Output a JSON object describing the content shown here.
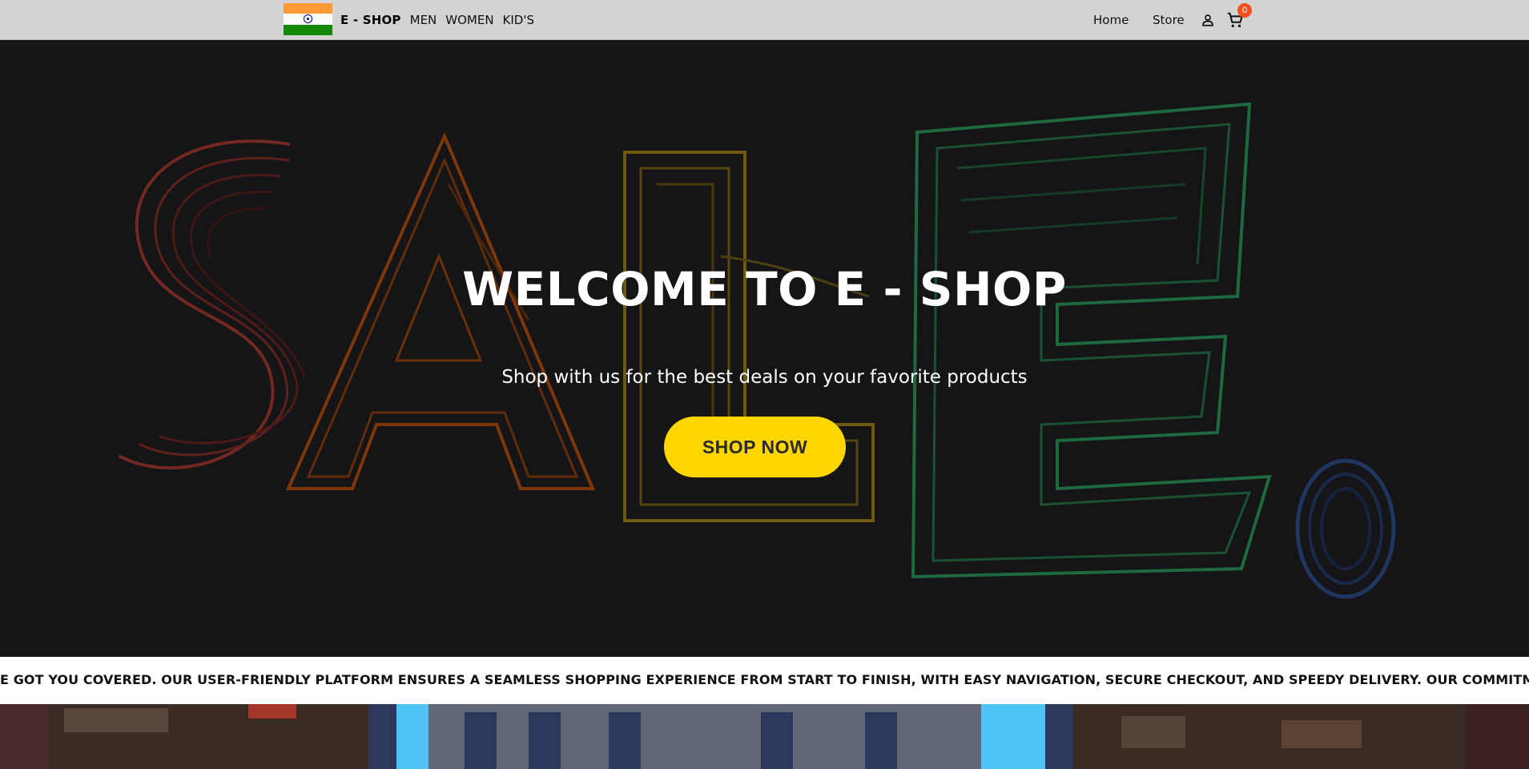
{
  "navbar": {
    "brand": "E - SHOP",
    "links": [
      "MEN",
      "WOMEN",
      "KID'S"
    ],
    "right_links": [
      "Home",
      "Store"
    ],
    "cart_count": "0",
    "icons": [
      "india-flag-icon",
      "user-icon",
      "cart-icon"
    ]
  },
  "hero": {
    "title": "WELCOME TO E - SHOP",
    "subtitle": "Shop with us for the best deals on your favorite products",
    "cta_label": "SHOP NOW"
  },
  "marquee": {
    "text": "E GOT YOU COVERED. OUR USER-FRIENDLY PLATFORM ENSURES A SEAMLESS SHOPPING EXPERIENCE FROM START TO FINISH, WITH EASY NAVIGATION, SECURE CHECKOUT, AND SPEEDY DELIVERY. OUR COMMITMENT TO CUSTOMER SATISFACTION MEA"
  },
  "colors": {
    "navbar_bg": "#d3d3d3",
    "hero_bg": "#151517",
    "cta_bg": "#ffd600",
    "badge_bg": "#f4511e",
    "flag_saffron": "#ff9933",
    "flag_green": "#138808"
  }
}
